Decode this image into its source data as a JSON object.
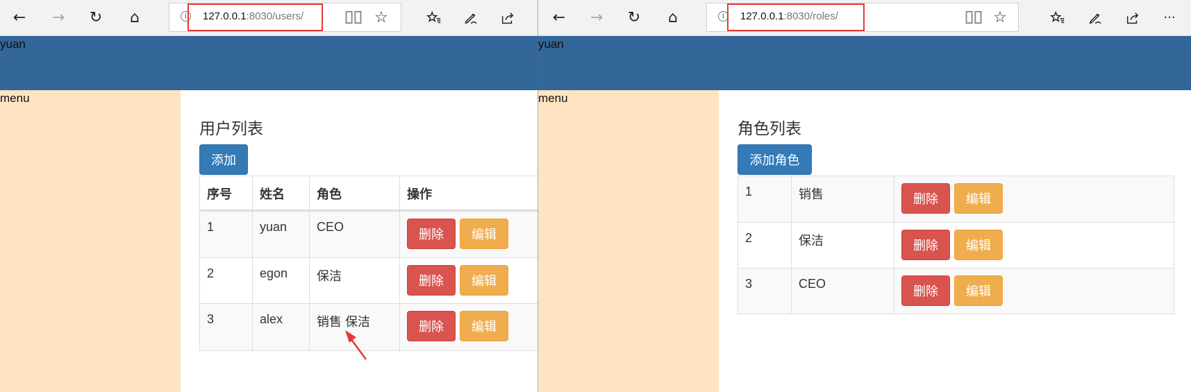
{
  "left_window": {
    "address": {
      "host": "127.0.0.1",
      "path": ":8030/users/"
    },
    "header_text": "yuan",
    "menu_text": "menu",
    "title": "用户列表",
    "add_button": "添加",
    "table": {
      "headers": [
        "序号",
        "姓名",
        "角色",
        "操作"
      ],
      "rows": [
        {
          "id": "1",
          "name": "yuan",
          "role": "CEO"
        },
        {
          "id": "2",
          "name": "egon",
          "role": "保洁"
        },
        {
          "id": "3",
          "name": "alex",
          "role": "销售 保洁"
        }
      ],
      "delete_label": "删除",
      "edit_label": "编辑"
    }
  },
  "right_window": {
    "address": {
      "host": "127.0.0.1",
      "path": ":8030/roles/"
    },
    "header_text": "yuan",
    "menu_text": "menu",
    "title": "角色列表",
    "add_button": "添加角色",
    "table": {
      "rows": [
        {
          "id": "1",
          "name": "销售"
        },
        {
          "id": "2",
          "name": "保洁"
        },
        {
          "id": "3",
          "name": "CEO"
        }
      ],
      "delete_label": "删除",
      "edit_label": "编辑"
    }
  },
  "icons": {
    "back": "←",
    "forward": "→",
    "refresh": "↻",
    "home": "⌂",
    "info": "i",
    "reading": "📖",
    "favorite": "☆",
    "favorites_hub": "☆≡",
    "notes": "✎",
    "share": "⇪",
    "more": "···"
  },
  "colors": {
    "header": "#336699",
    "menu": "#ffe4c4",
    "primary": "#337ab7",
    "danger": "#d9534f",
    "warning": "#f0ad4e",
    "highlight": "#e53935"
  }
}
